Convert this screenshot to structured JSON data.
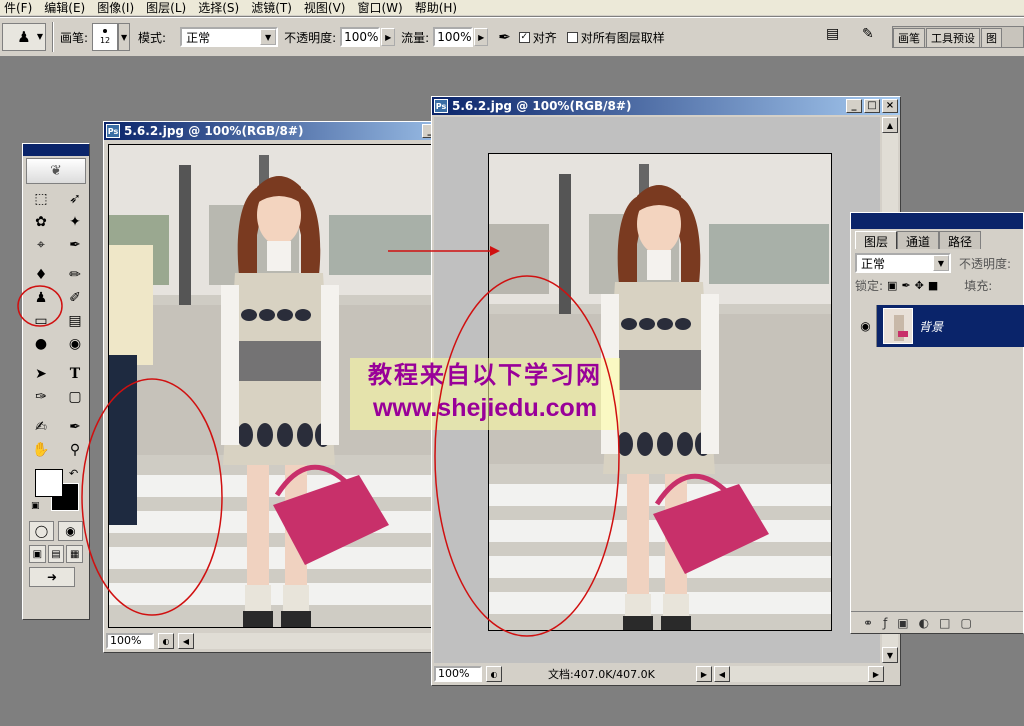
{
  "menu": {
    "items": [
      "件(F)",
      "编辑(E)",
      "图像(I)",
      "图层(L)",
      "选择(S)",
      "滤镜(T)",
      "视图(V)",
      "窗口(W)",
      "帮助(H)"
    ]
  },
  "options": {
    "brush_label": "画笔:",
    "brush_size": "12",
    "mode_label": "模式:",
    "mode_value": "正常",
    "opacity_label": "不透明度:",
    "opacity_value": "100%",
    "flow_label": "流量:",
    "flow_value": "100%",
    "aligned_label": "对齐",
    "sample_all_label": "对所有图层取样",
    "palette_tabs": [
      "画笔",
      "工具预设",
      "图"
    ]
  },
  "doc_left": {
    "title": "5.6.2.jpg @ 100%(RGB/8#)",
    "zoom": "100%"
  },
  "doc_right": {
    "title": "5.6.2.jpg @ 100%(RGB/8#)",
    "zoom": "100%",
    "doc_info": "文档:407.0K/407.0K"
  },
  "watermark": {
    "line1": "教程来自以下学习网",
    "line2": "www.shejiedu.com"
  },
  "layers_palette": {
    "tabs": [
      "图层",
      "通道",
      "路径"
    ],
    "blend_mode": "正常",
    "opacity_label": "不透明度:",
    "lock_label": "锁定:",
    "fill_label": "填充:",
    "layer_name": "背景"
  },
  "colors": {
    "annotation_red": "#d01010",
    "title_active": "#0a246a",
    "workspace": "#7f7f7f",
    "handbag": "#c8306a"
  }
}
